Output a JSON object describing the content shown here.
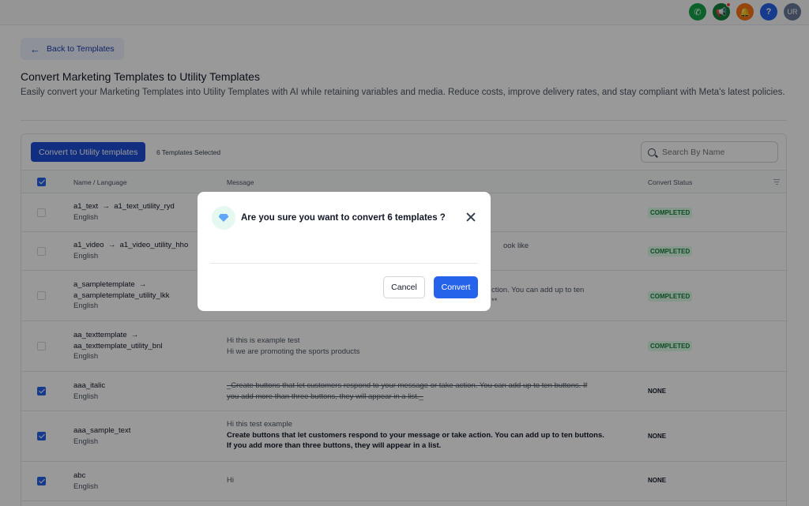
{
  "topbar": {
    "icons": [
      "phone-icon",
      "megaphone-icon",
      "bell-icon",
      "help-icon",
      "avatar"
    ],
    "help_label": "?",
    "avatar_initials": "UR"
  },
  "back": {
    "label": "Back to Templates"
  },
  "page": {
    "title": "Convert Marketing Templates to Utility Templates",
    "subtitle": "Easily convert your Marketing Templates into Utility Templates with AI while retaining variables and media. Reduce costs, improve delivery rates, and stay compliant with Meta's latest policies."
  },
  "toolbar": {
    "convert_label": "Convert to Utility templates",
    "selected_count": "6 Templates Selected",
    "search_placeholder": "Search By Name"
  },
  "table": {
    "headers": {
      "name": "Name / Language",
      "message": "Message",
      "status": "Convert Status"
    },
    "rows": [
      {
        "checked": false,
        "name": "a1_text",
        "arrow": "→",
        "target": "a1_text_utility_ryd",
        "language": "English",
        "message_lines": [],
        "status": "COMPLETED"
      },
      {
        "checked": false,
        "name": "a1_video",
        "arrow": "→",
        "target": "a1_video_utility_hho",
        "language": "English",
        "message_lines": [
          "ook like"
        ],
        "status": "COMPLETED"
      },
      {
        "checked": false,
        "name": "a_sampletemplate",
        "arrow": "→",
        "target": "a_sampletemplate_utility_lkk",
        "language": "English",
        "message_lines": [
          "ction. You can add up to ten",
          "**"
        ],
        "status": "COMPLETED"
      },
      {
        "checked": false,
        "name": "aa_texttemplate",
        "arrow": "→",
        "target": "aa_texttemplate_utility_bnl",
        "language": "English",
        "message_lines": [
          "Hi this is example test",
          "Hi we are promoting the sports products"
        ],
        "status": "COMPLETED"
      },
      {
        "checked": true,
        "name": "aaa_italic",
        "language": "English",
        "message_lines": [
          "_Create buttons that let customers respond to your message or take action. You can add up to ten buttons. If",
          "you add more than three buttons, they will appear in a list._"
        ],
        "status": "NONE"
      },
      {
        "checked": true,
        "name": "aaa_sample_text",
        "language": "English",
        "message_lines": [
          "Hi this test example"
        ],
        "message_bold_lines": [
          "Create buttons that let customers respond to your message or take action. You can add up to ten buttons.",
          "If you add more than three buttons, they will appear in a list."
        ],
        "status": "NONE"
      },
      {
        "checked": true,
        "name": "abc",
        "language": "English",
        "message_lines": [
          "Hi"
        ],
        "status": "NONE"
      }
    ]
  },
  "modal": {
    "title": "Are you sure you want to convert 6 templates ?",
    "cancel_label": "Cancel",
    "confirm_label": "Convert"
  },
  "colors": {
    "primary": "#2563eb",
    "completed_text": "#15803d",
    "completed_bg": "#dcfce7"
  }
}
